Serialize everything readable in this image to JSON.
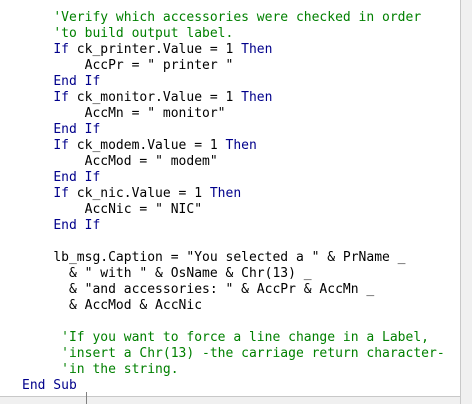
{
  "colors": {
    "keyword": "#00008b",
    "comment": "#008000",
    "text": "#000000",
    "background": "#ffffff"
  },
  "code_lines": [
    {
      "indent": "    ",
      "segments": [
        {
          "t": "cm",
          "s": "'Verify which accessories were checked in order"
        }
      ]
    },
    {
      "indent": "    ",
      "segments": [
        {
          "t": "cm",
          "s": "'to build output label."
        }
      ]
    },
    {
      "indent": "    ",
      "segments": [
        {
          "t": "kw",
          "s": "If"
        },
        {
          "t": "tx",
          "s": " ck_printer.Value = 1 "
        },
        {
          "t": "kw",
          "s": "Then"
        }
      ]
    },
    {
      "indent": "        ",
      "segments": [
        {
          "t": "tx",
          "s": "AccPr = \" printer \""
        }
      ]
    },
    {
      "indent": "    ",
      "segments": [
        {
          "t": "kw",
          "s": "End If"
        }
      ]
    },
    {
      "indent": "    ",
      "segments": [
        {
          "t": "kw",
          "s": "If"
        },
        {
          "t": "tx",
          "s": " ck_monitor.Value = 1 "
        },
        {
          "t": "kw",
          "s": "Then"
        }
      ]
    },
    {
      "indent": "        ",
      "segments": [
        {
          "t": "tx",
          "s": "AccMn = \" monitor\""
        }
      ]
    },
    {
      "indent": "    ",
      "segments": [
        {
          "t": "kw",
          "s": "End If"
        }
      ]
    },
    {
      "indent": "    ",
      "segments": [
        {
          "t": "kw",
          "s": "If"
        },
        {
          "t": "tx",
          "s": " ck_modem.Value = 1 "
        },
        {
          "t": "kw",
          "s": "Then"
        }
      ]
    },
    {
      "indent": "        ",
      "segments": [
        {
          "t": "tx",
          "s": "AccMod = \" modem\""
        }
      ]
    },
    {
      "indent": "    ",
      "segments": [
        {
          "t": "kw",
          "s": "End If"
        }
      ]
    },
    {
      "indent": "    ",
      "segments": [
        {
          "t": "kw",
          "s": "If"
        },
        {
          "t": "tx",
          "s": " ck_nic.Value = 1 "
        },
        {
          "t": "kw",
          "s": "Then"
        }
      ]
    },
    {
      "indent": "        ",
      "segments": [
        {
          "t": "tx",
          "s": "AccNic = \" NIC\""
        }
      ]
    },
    {
      "indent": "    ",
      "segments": [
        {
          "t": "kw",
          "s": "End If"
        }
      ]
    },
    {
      "indent": "",
      "segments": []
    },
    {
      "indent": "    ",
      "segments": [
        {
          "t": "tx",
          "s": "lb_msg.Caption = \"You selected a \" & PrName _"
        }
      ]
    },
    {
      "indent": "      ",
      "segments": [
        {
          "t": "tx",
          "s": "& \" with \" & OsName & Chr(13) _"
        }
      ]
    },
    {
      "indent": "      ",
      "segments": [
        {
          "t": "tx",
          "s": "& \"and accessories: \" & AccPr & AccMn _"
        }
      ]
    },
    {
      "indent": "      ",
      "segments": [
        {
          "t": "tx",
          "s": "& AccMod & AccNic"
        }
      ]
    },
    {
      "indent": "",
      "segments": []
    },
    {
      "indent": "     ",
      "segments": [
        {
          "t": "cm",
          "s": "'If you want to force a line change in a Label,"
        }
      ]
    },
    {
      "indent": "     ",
      "segments": [
        {
          "t": "cm",
          "s": "'insert a Chr(13) -the carriage return character-"
        }
      ]
    },
    {
      "indent": "     ",
      "segments": [
        {
          "t": "cm",
          "s": "'in the string."
        }
      ]
    },
    {
      "indent": "",
      "segments": [
        {
          "t": "kw",
          "s": "End Sub"
        }
      ]
    }
  ]
}
